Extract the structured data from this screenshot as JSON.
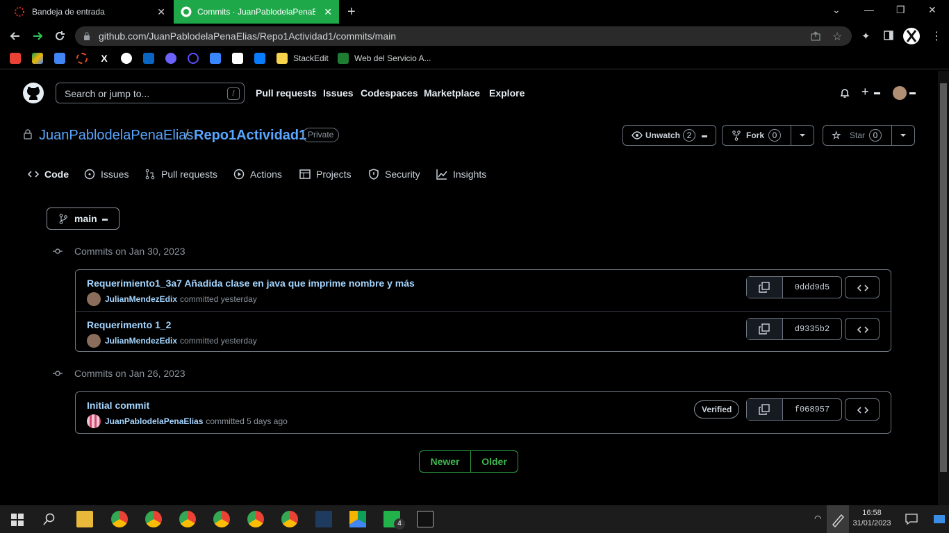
{
  "browser": {
    "tabs": [
      {
        "title": "Bandeja de entrada",
        "active": false
      },
      {
        "title": "Commits · JuanPablodelaPenaElias",
        "active": true
      }
    ],
    "url": "github.com/JuanPablodelaPenaElias/Repo1Actividad1/commits/main",
    "bookmarks": [
      {
        "icon": "gmail-icon"
      },
      {
        "icon": "drive-icon"
      },
      {
        "icon": "calendar-icon"
      },
      {
        "icon": "circle-icon"
      },
      {
        "icon": "x-icon"
      },
      {
        "icon": "github-icon"
      },
      {
        "icon": "linkedin-icon"
      },
      {
        "icon": "play-icon"
      },
      {
        "icon": "search-icon"
      },
      {
        "icon": "apps-icon"
      },
      {
        "icon": "sheet-icon"
      },
      {
        "icon": "intellij-icon"
      },
      {
        "label": "StackEdit",
        "icon": "stackedit-icon"
      },
      {
        "label": "Web del Servicio A...",
        "icon": "andalucia-icon"
      }
    ]
  },
  "header": {
    "search_placeholder": "Search or jump to...",
    "search_shortcut": "/",
    "nav": [
      "Pull requests",
      "Issues",
      "Codespaces",
      "Marketplace",
      "Explore"
    ]
  },
  "repo": {
    "owner": "JuanPablodelaPenaElias",
    "separator": "/",
    "name": "Repo1Actividad1",
    "visibility": "Private",
    "watch_label": "Unwatch",
    "watch_count": "2",
    "fork_label": "Fork",
    "fork_count": "0",
    "star_label": "Star",
    "star_count": "0",
    "tabs": [
      "Code",
      "Issues",
      "Pull requests",
      "Actions",
      "Projects",
      "Security",
      "Insights"
    ]
  },
  "branch": "main",
  "groups": [
    {
      "heading": "Commits on Jan 30, 2023",
      "commits": [
        {
          "message": "Requerimiento1_3a7 Añadida clase en java que imprime nombre y más",
          "author": "JulianMendezEdix",
          "when": "committed yesterday",
          "sha": "0ddd9d5"
        },
        {
          "message": "Requerimento 1_2",
          "author": "JulianMendezEdix",
          "when": "committed yesterday",
          "sha": "d9335b2"
        }
      ]
    },
    {
      "heading": "Commits on Jan 26, 2023",
      "commits": [
        {
          "message": "Initial commit",
          "author": "JuanPablodelaPenaElias",
          "when": "committed 5 days ago",
          "sha": "f068957",
          "badge": "Verified"
        }
      ]
    }
  ],
  "pager": {
    "newer": "Newer",
    "older": "Older"
  },
  "taskbar": {
    "time": "16:58",
    "date": "31/01/2023",
    "badge_count": "4"
  }
}
